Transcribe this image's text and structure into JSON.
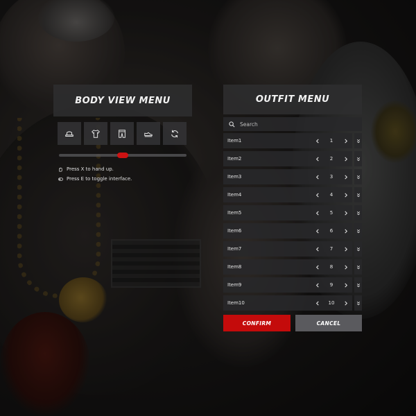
{
  "body_view_menu": {
    "title": "BODY VIEW MENU",
    "categories": [
      {
        "icon": "hat-icon"
      },
      {
        "icon": "shirt-icon"
      },
      {
        "icon": "pants-icon"
      },
      {
        "icon": "shoe-icon"
      },
      {
        "icon": "rotate-icon"
      }
    ],
    "slider": {
      "value": 0.5
    },
    "hints": [
      {
        "icon": "hand-icon",
        "text": "Press X to hand up."
      },
      {
        "icon": "toggle-icon",
        "text": "Press E to toggle interface."
      }
    ]
  },
  "outfit_menu": {
    "title": "OUTFIT MENU",
    "search": {
      "placeholder": "Search"
    },
    "items": [
      {
        "label": "Item1",
        "value": "1"
      },
      {
        "label": "Item2",
        "value": "2"
      },
      {
        "label": "Item3",
        "value": "3"
      },
      {
        "label": "Item4",
        "value": "4"
      },
      {
        "label": "Item5",
        "value": "5"
      },
      {
        "label": "Item6",
        "value": "6"
      },
      {
        "label": "Item7",
        "value": "7"
      },
      {
        "label": "Item8",
        "value": "8"
      },
      {
        "label": "Item9",
        "value": "9"
      },
      {
        "label": "Item10",
        "value": "10"
      }
    ],
    "confirm_label": "CONFIRM",
    "cancel_label": "CANCEL"
  },
  "colors": {
    "accent": "#c40b0b",
    "panel": "#2d2d2f",
    "cancel": "#5a5a5e"
  }
}
